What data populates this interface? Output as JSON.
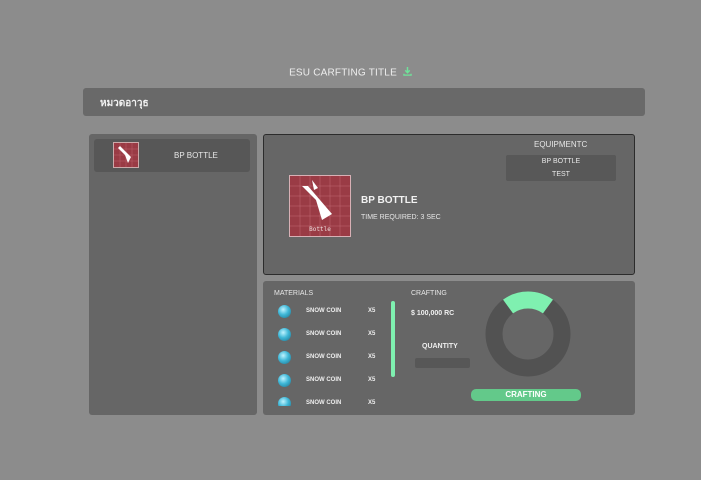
{
  "header": {
    "title": "ESU CARFTING TITLE",
    "download_icon": "download-icon",
    "accent": "#6fe39a"
  },
  "category": {
    "label": "หมวดอาวุธ"
  },
  "item_list": [
    {
      "label": "BP BOTTLE",
      "icon": "bottle-thumbnail"
    }
  ],
  "detail": {
    "name": "BP BOTTLE",
    "time_required": "TIME REQUIRED: 3 SEC",
    "thumbnail_caption": "Bottle",
    "equipment_title": "EQUIPMENTC",
    "equipment": [
      "BP BOTTLE",
      "TEST"
    ],
    "thumbnail_color": "#9a3b45"
  },
  "materials": {
    "title": "MATERIALS",
    "items": [
      {
        "name": "SNOW COIN",
        "qty": "X5",
        "icon": "snow-coin-icon"
      },
      {
        "name": "SNOW COIN",
        "qty": "X5",
        "icon": "snow-coin-icon"
      },
      {
        "name": "SNOW COIN",
        "qty": "X5",
        "icon": "snow-coin-icon"
      },
      {
        "name": "SNOW COIN",
        "qty": "X5",
        "icon": "snow-coin-icon"
      },
      {
        "name": "SNOW COIN",
        "qty": "X5",
        "icon": "snow-coin-icon"
      }
    ]
  },
  "crafting": {
    "title": "CRAFTING",
    "price": "$ 100,000 RC",
    "quantity_label": "QUANTITY",
    "quantity_value": "",
    "progress_fraction": 0.2,
    "button_label": "CRAFTING",
    "progress_color": "#7ff0b0",
    "button_color": "#63c98a"
  }
}
